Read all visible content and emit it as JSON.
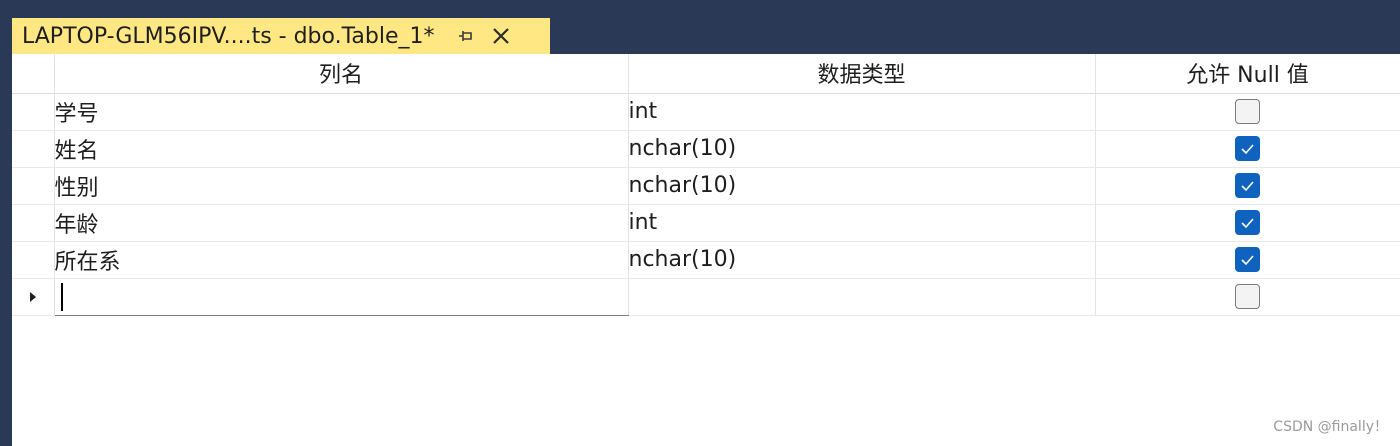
{
  "tab": {
    "title": "LAPTOP-GLM56IPV....ts - dbo.Table_1*",
    "pin_icon": "pin-icon",
    "close_icon": "close-icon"
  },
  "grid": {
    "headers": [
      "列名",
      "数据类型",
      "允许 Null 值"
    ],
    "rows": [
      {
        "name": "学号",
        "type": "int",
        "allow_null": false
      },
      {
        "name": "姓名",
        "type": "nchar(10)",
        "allow_null": true
      },
      {
        "name": "性别",
        "type": "nchar(10)",
        "allow_null": true
      },
      {
        "name": "年龄",
        "type": "int",
        "allow_null": true
      },
      {
        "name": "所在系",
        "type": "nchar(10)",
        "allow_null": true
      }
    ],
    "new_row": {
      "name": "",
      "type": "",
      "allow_null": false
    }
  },
  "colors": {
    "titlebar": "#293956",
    "tab_active": "#ffe883",
    "checkbox_checked": "#0f62be"
  },
  "watermark": "CSDN @finally！"
}
